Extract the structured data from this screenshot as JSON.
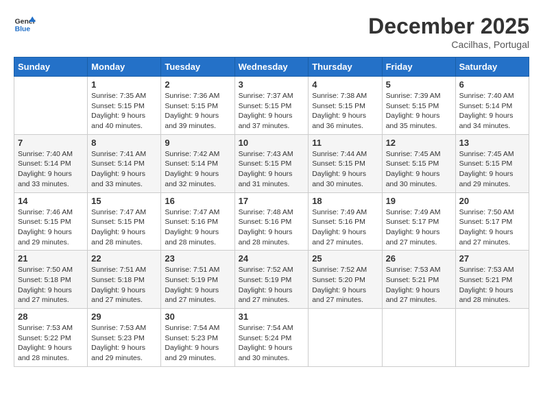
{
  "header": {
    "logo_line1": "General",
    "logo_line2": "Blue",
    "month": "December 2025",
    "location": "Cacilhas, Portugal"
  },
  "weekdays": [
    "Sunday",
    "Monday",
    "Tuesday",
    "Wednesday",
    "Thursday",
    "Friday",
    "Saturday"
  ],
  "weeks": [
    [
      {
        "day": "",
        "info": ""
      },
      {
        "day": "1",
        "info": "Sunrise: 7:35 AM\nSunset: 5:15 PM\nDaylight: 9 hours\nand 40 minutes."
      },
      {
        "day": "2",
        "info": "Sunrise: 7:36 AM\nSunset: 5:15 PM\nDaylight: 9 hours\nand 39 minutes."
      },
      {
        "day": "3",
        "info": "Sunrise: 7:37 AM\nSunset: 5:15 PM\nDaylight: 9 hours\nand 37 minutes."
      },
      {
        "day": "4",
        "info": "Sunrise: 7:38 AM\nSunset: 5:15 PM\nDaylight: 9 hours\nand 36 minutes."
      },
      {
        "day": "5",
        "info": "Sunrise: 7:39 AM\nSunset: 5:15 PM\nDaylight: 9 hours\nand 35 minutes."
      },
      {
        "day": "6",
        "info": "Sunrise: 7:40 AM\nSunset: 5:14 PM\nDaylight: 9 hours\nand 34 minutes."
      }
    ],
    [
      {
        "day": "7",
        "info": "Sunrise: 7:40 AM\nSunset: 5:14 PM\nDaylight: 9 hours\nand 33 minutes."
      },
      {
        "day": "8",
        "info": "Sunrise: 7:41 AM\nSunset: 5:14 PM\nDaylight: 9 hours\nand 33 minutes."
      },
      {
        "day": "9",
        "info": "Sunrise: 7:42 AM\nSunset: 5:14 PM\nDaylight: 9 hours\nand 32 minutes."
      },
      {
        "day": "10",
        "info": "Sunrise: 7:43 AM\nSunset: 5:15 PM\nDaylight: 9 hours\nand 31 minutes."
      },
      {
        "day": "11",
        "info": "Sunrise: 7:44 AM\nSunset: 5:15 PM\nDaylight: 9 hours\nand 30 minutes."
      },
      {
        "day": "12",
        "info": "Sunrise: 7:45 AM\nSunset: 5:15 PM\nDaylight: 9 hours\nand 30 minutes."
      },
      {
        "day": "13",
        "info": "Sunrise: 7:45 AM\nSunset: 5:15 PM\nDaylight: 9 hours\nand 29 minutes."
      }
    ],
    [
      {
        "day": "14",
        "info": "Sunrise: 7:46 AM\nSunset: 5:15 PM\nDaylight: 9 hours\nand 29 minutes."
      },
      {
        "day": "15",
        "info": "Sunrise: 7:47 AM\nSunset: 5:15 PM\nDaylight: 9 hours\nand 28 minutes."
      },
      {
        "day": "16",
        "info": "Sunrise: 7:47 AM\nSunset: 5:16 PM\nDaylight: 9 hours\nand 28 minutes."
      },
      {
        "day": "17",
        "info": "Sunrise: 7:48 AM\nSunset: 5:16 PM\nDaylight: 9 hours\nand 28 minutes."
      },
      {
        "day": "18",
        "info": "Sunrise: 7:49 AM\nSunset: 5:16 PM\nDaylight: 9 hours\nand 27 minutes."
      },
      {
        "day": "19",
        "info": "Sunrise: 7:49 AM\nSunset: 5:17 PM\nDaylight: 9 hours\nand 27 minutes."
      },
      {
        "day": "20",
        "info": "Sunrise: 7:50 AM\nSunset: 5:17 PM\nDaylight: 9 hours\nand 27 minutes."
      }
    ],
    [
      {
        "day": "21",
        "info": "Sunrise: 7:50 AM\nSunset: 5:18 PM\nDaylight: 9 hours\nand 27 minutes."
      },
      {
        "day": "22",
        "info": "Sunrise: 7:51 AM\nSunset: 5:18 PM\nDaylight: 9 hours\nand 27 minutes."
      },
      {
        "day": "23",
        "info": "Sunrise: 7:51 AM\nSunset: 5:19 PM\nDaylight: 9 hours\nand 27 minutes."
      },
      {
        "day": "24",
        "info": "Sunrise: 7:52 AM\nSunset: 5:19 PM\nDaylight: 9 hours\nand 27 minutes."
      },
      {
        "day": "25",
        "info": "Sunrise: 7:52 AM\nSunset: 5:20 PM\nDaylight: 9 hours\nand 27 minutes."
      },
      {
        "day": "26",
        "info": "Sunrise: 7:53 AM\nSunset: 5:21 PM\nDaylight: 9 hours\nand 27 minutes."
      },
      {
        "day": "27",
        "info": "Sunrise: 7:53 AM\nSunset: 5:21 PM\nDaylight: 9 hours\nand 28 minutes."
      }
    ],
    [
      {
        "day": "28",
        "info": "Sunrise: 7:53 AM\nSunset: 5:22 PM\nDaylight: 9 hours\nand 28 minutes."
      },
      {
        "day": "29",
        "info": "Sunrise: 7:53 AM\nSunset: 5:23 PM\nDaylight: 9 hours\nand 29 minutes."
      },
      {
        "day": "30",
        "info": "Sunrise: 7:54 AM\nSunset: 5:23 PM\nDaylight: 9 hours\nand 29 minutes."
      },
      {
        "day": "31",
        "info": "Sunrise: 7:54 AM\nSunset: 5:24 PM\nDaylight: 9 hours\nand 30 minutes."
      },
      {
        "day": "",
        "info": ""
      },
      {
        "day": "",
        "info": ""
      },
      {
        "day": "",
        "info": ""
      }
    ]
  ]
}
